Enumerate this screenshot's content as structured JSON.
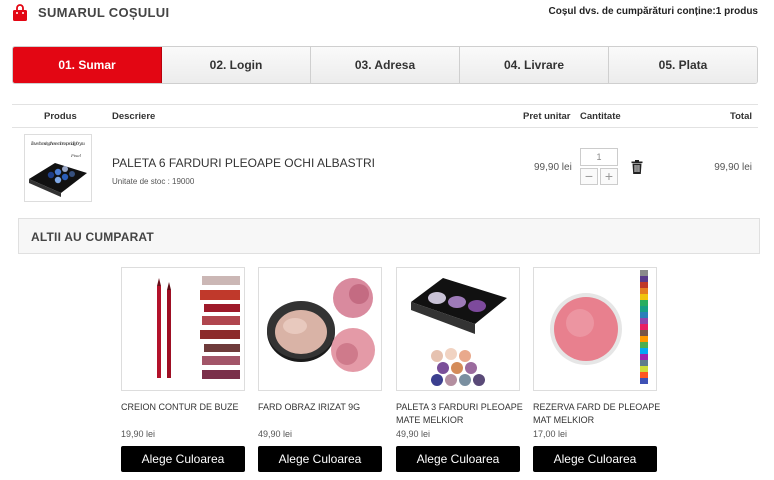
{
  "header": {
    "title": "SUMARUL COȘULUI",
    "cart_summary": "Coșul dvs. de cumpărături conține:1 produs",
    "accent": "#e30613"
  },
  "steps": [
    {
      "label": "01. Sumar",
      "active": true
    },
    {
      "label": "02. Login",
      "active": false
    },
    {
      "label": "03. Adresa",
      "active": false
    },
    {
      "label": "04. Livrare",
      "active": false
    },
    {
      "label": "05. Plata",
      "active": false
    }
  ],
  "table": {
    "headers": {
      "product": "Produs",
      "description": "Descriere",
      "unit_price": "Pret unitar",
      "quantity": "Cantitate",
      "total": "Total"
    },
    "rows": [
      {
        "name": "PALETA 6 FARDURI PLEOAPE OCHI ALBASTRI",
        "sku": "Unitate de stoc : 19000",
        "unit_price": "99,90 lei",
        "quantity": "1",
        "minus": "−",
        "plus": "+",
        "total": "99,90 lei",
        "thumb_text": "I love choosing these colors specially for you",
        "thumb_brand": "Pixel"
      }
    ]
  },
  "others": {
    "title": "ALTII AU CUMPARAT",
    "products": [
      {
        "name": "CREION CONTUR DE BUZE",
        "price": "19,90 lei",
        "button": "Alege Culoarea"
      },
      {
        "name": "FARD OBRAZ IRIZAT 9G",
        "price": "49,90 lei",
        "button": "Alege Culoarea"
      },
      {
        "name": "PALETA 3 FARDURI PLEOAPE MATE MELKIOR",
        "price": "49,90 lei",
        "button": "Alege Culoarea"
      },
      {
        "name": "REZERVA FARD DE PLEOAPE MAT MELKIOR",
        "price": "17,00 lei",
        "button": "Alege Culoarea"
      }
    ]
  }
}
